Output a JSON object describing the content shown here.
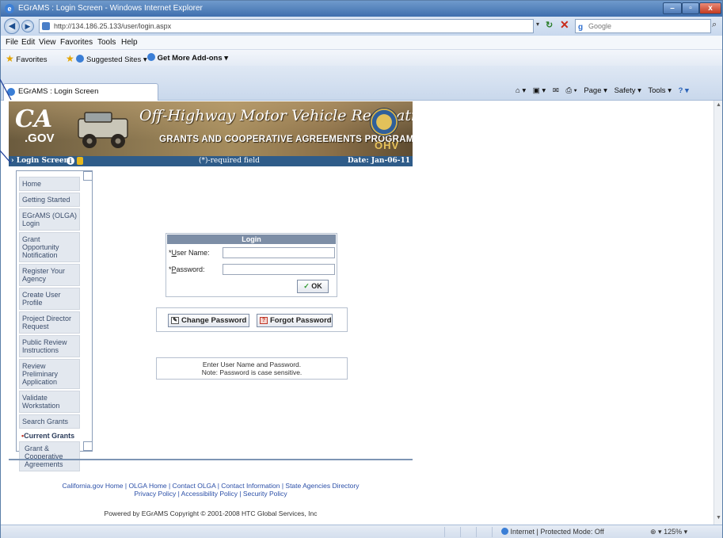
{
  "window": {
    "title": "EGrAMS : Login Screen - Windows Internet Explorer",
    "btn_min": "–",
    "btn_max": "▫",
    "btn_close": "x"
  },
  "addressbar": {
    "url": "http://134.186.25.133/user/login.aspx",
    "search_placeholder": "Google"
  },
  "menu": [
    "File",
    "Edit",
    "View",
    "Favorites",
    "Tools",
    "Help"
  ],
  "favorites": {
    "favorites_label": "Favorites",
    "suggested_sites": "Suggested Sites ▾",
    "get_addons": "Get More Add-ons ▾"
  },
  "tab": {
    "title": "EGrAMS : Login Screen"
  },
  "commandbar": {
    "page": "Page ▾",
    "safety": "Safety ▾",
    "tools": "Tools ▾"
  },
  "banner": {
    "logo_ca": "CA",
    "logo_gov": ".GOV",
    "title": "Off-Highway Motor Vehicle Recreation",
    "subtitle": "GRANTS AND COOPERATIVE AGREEMENTS PROGRAM",
    "ohv": "OHV"
  },
  "strip": {
    "screen": "Login Screen",
    "required": "(*)-required field",
    "date": "Date: Jan-06-11"
  },
  "nav": {
    "items": [
      "Home",
      "Getting Started",
      "EGrAMS (OLGA) Login",
      "Grant Opportunity Notification",
      "Register Your Agency",
      "Create User Profile",
      "Project Director Request",
      "Public Review Instructions",
      "Review Preliminary Application",
      "Validate Workstation",
      "Search Grants"
    ],
    "heading": "Current Grants",
    "sub": "Grant & Cooperative Agreements"
  },
  "login": {
    "heading": "Login",
    "username_prefix": "*",
    "username_ul": "U",
    "username_rest": "ser Name:",
    "password_prefix": "*",
    "password_ul": "P",
    "password_rest": "assword:",
    "ok": "OK"
  },
  "actions": {
    "change_password": "Change Password",
    "forgot_password": "Forgot Password"
  },
  "message": {
    "line1": "Enter User Name and Password.",
    "line2": "Note: Password is case sensitive."
  },
  "footer": {
    "links_line1": "California.gov Home | OLGA Home | Contact OLGA | Contact Information | State Agencies Directory",
    "links_line2": "Privacy Policy | Accessibility Policy | Security Policy",
    "copyright": "Powered by EGrAMS Copyright © 2001-2008 HTC Global Services, Inc"
  },
  "statusbar": {
    "zone": "Internet | Protected Mode: Off",
    "zoom": "125% ▾"
  }
}
